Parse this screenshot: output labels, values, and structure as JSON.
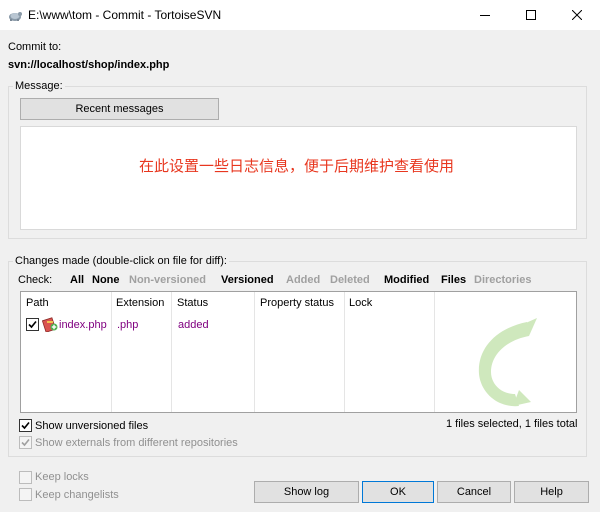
{
  "window": {
    "title": "E:\\www\\tom - Commit - TortoiseSVN"
  },
  "commit_to": {
    "label": "Commit to:",
    "url": "svn://localhost/shop/index.php"
  },
  "message": {
    "group_label": "Message:",
    "recent_button": "Recent messages",
    "text": "在此设置一些日志信息，便于后期维护查看使用"
  },
  "changes": {
    "group_label": "Changes made (double-click on file for diff):",
    "check_label": "Check:",
    "filters": {
      "all": "All",
      "none": "None",
      "non_versioned": "Non-versioned",
      "versioned": "Versioned",
      "added": "Added",
      "deleted": "Deleted",
      "modified": "Modified",
      "files": "Files",
      "directories": "Directories"
    },
    "columns": {
      "path": "Path",
      "extension": "Extension",
      "status": "Status",
      "property_status": "Property status",
      "lock": "Lock"
    },
    "rows": [
      {
        "path": "index.php",
        "extension": ".php",
        "status": "added",
        "checked": true
      }
    ],
    "show_unversioned": {
      "label": "Show unversioned files",
      "checked": true
    },
    "show_externals": {
      "label": "Show externals from different repositories",
      "checked": true,
      "enabled": false
    },
    "summary": "1 files selected, 1 files total"
  },
  "options": {
    "keep_locks": {
      "label": "Keep locks",
      "checked": false,
      "enabled": false
    },
    "keep_changelists": {
      "label": "Keep changelists",
      "checked": false,
      "enabled": false
    }
  },
  "buttons": {
    "show_log": "Show log",
    "ok": "OK",
    "cancel": "Cancel",
    "help": "Help"
  },
  "colors": {
    "message_text": "#e8371f",
    "added_status": "#800080",
    "disabled_text": "#a0a0a0",
    "watermark": "#7fbf4d"
  }
}
